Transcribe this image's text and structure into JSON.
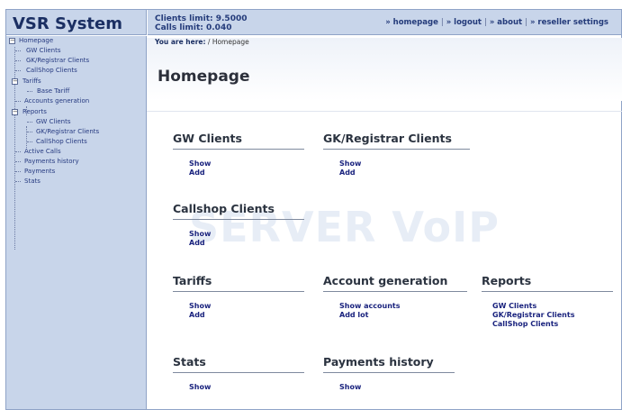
{
  "app": {
    "title": "VSR System"
  },
  "header": {
    "clients_limit": "Clients limit: 9.5000",
    "calls_limit": "Calls limit: 0.040",
    "nav": [
      "» homepage",
      "» logout",
      "» about",
      "» reseller settings"
    ]
  },
  "sidebar": {
    "homepage": "Homepage",
    "gw_clients": "GW Clients",
    "gk_registrar_clients": "GK/Registrar Clients",
    "callshop_clients": "CallShop Clients",
    "tariffs": "Tariffs",
    "base_tariff": "Base Tariff",
    "accounts_generation": "Accounts generation",
    "reports": "Reports",
    "reports_gw": "GW Clients",
    "reports_gk": "GK/Registrar Clients",
    "reports_callshop": "CallShop Clients",
    "active_calls": "Active Calls",
    "payments_history": "Payments history",
    "payments": "Payments",
    "stats": "Stats"
  },
  "breadcrumb": {
    "prefix": "You are here:",
    "current": "/ Homepage"
  },
  "page": {
    "title": "Homepage",
    "watermark": "SERVER VoIP"
  },
  "sections": {
    "gw_clients": {
      "title": "GW Clients",
      "links": [
        "Show",
        "Add"
      ]
    },
    "gk_clients": {
      "title": "GK/Registrar Clients",
      "links": [
        "Show",
        "Add"
      ]
    },
    "callshop": {
      "title": "Callshop Clients",
      "links": [
        "Show",
        "Add"
      ]
    },
    "tariffs": {
      "title": "Tariffs",
      "links": [
        "Show",
        "Add"
      ]
    },
    "account_gen": {
      "title": "Account generation",
      "links": [
        "Show accounts",
        "Add lot"
      ]
    },
    "reports": {
      "title": "Reports",
      "links": [
        "GW Clients",
        "GK/Registrar Clients",
        "CallShop Clients"
      ]
    },
    "stats": {
      "title": "Stats",
      "links": [
        "Show"
      ]
    },
    "payments_history": {
      "title": "Payments history",
      "links": [
        "Show"
      ]
    }
  }
}
